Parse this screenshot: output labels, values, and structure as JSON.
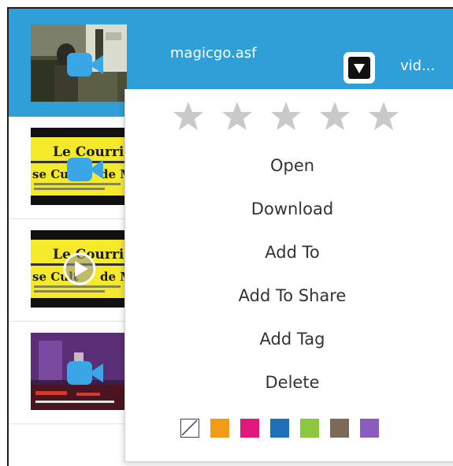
{
  "file_list": {
    "selected_row": {
      "filename": "magicgo.asf",
      "type_truncated": "vid..."
    },
    "rows": [
      {
        "thumbnail": "outdoor-scene",
        "badge": "video-camera-icon"
      },
      {
        "thumbnail": "le-courrier-newspaper",
        "badge": "video-camera-icon"
      },
      {
        "thumbnail": "le-courrier-newspaper",
        "badge": "play-icon"
      },
      {
        "thumbnail": "stage-event",
        "badge": "video-camera-icon"
      }
    ]
  },
  "context_menu": {
    "rating": {
      "max": 5,
      "value": 0
    },
    "items": [
      {
        "label": "Open"
      },
      {
        "label": "Download"
      },
      {
        "label": "Add To"
      },
      {
        "label": "Add To Share"
      },
      {
        "label": "Add Tag"
      },
      {
        "label": "Delete"
      }
    ],
    "color_labels": [
      "none",
      "#f29b1b",
      "#e2187c",
      "#1d6fb8",
      "#8cc63f",
      "#7b6a58",
      "#8b5bc2"
    ]
  },
  "colors": {
    "selected_row": "#2f9fd8",
    "badge": "#3aa6e6",
    "star": "#c9c9c9"
  }
}
